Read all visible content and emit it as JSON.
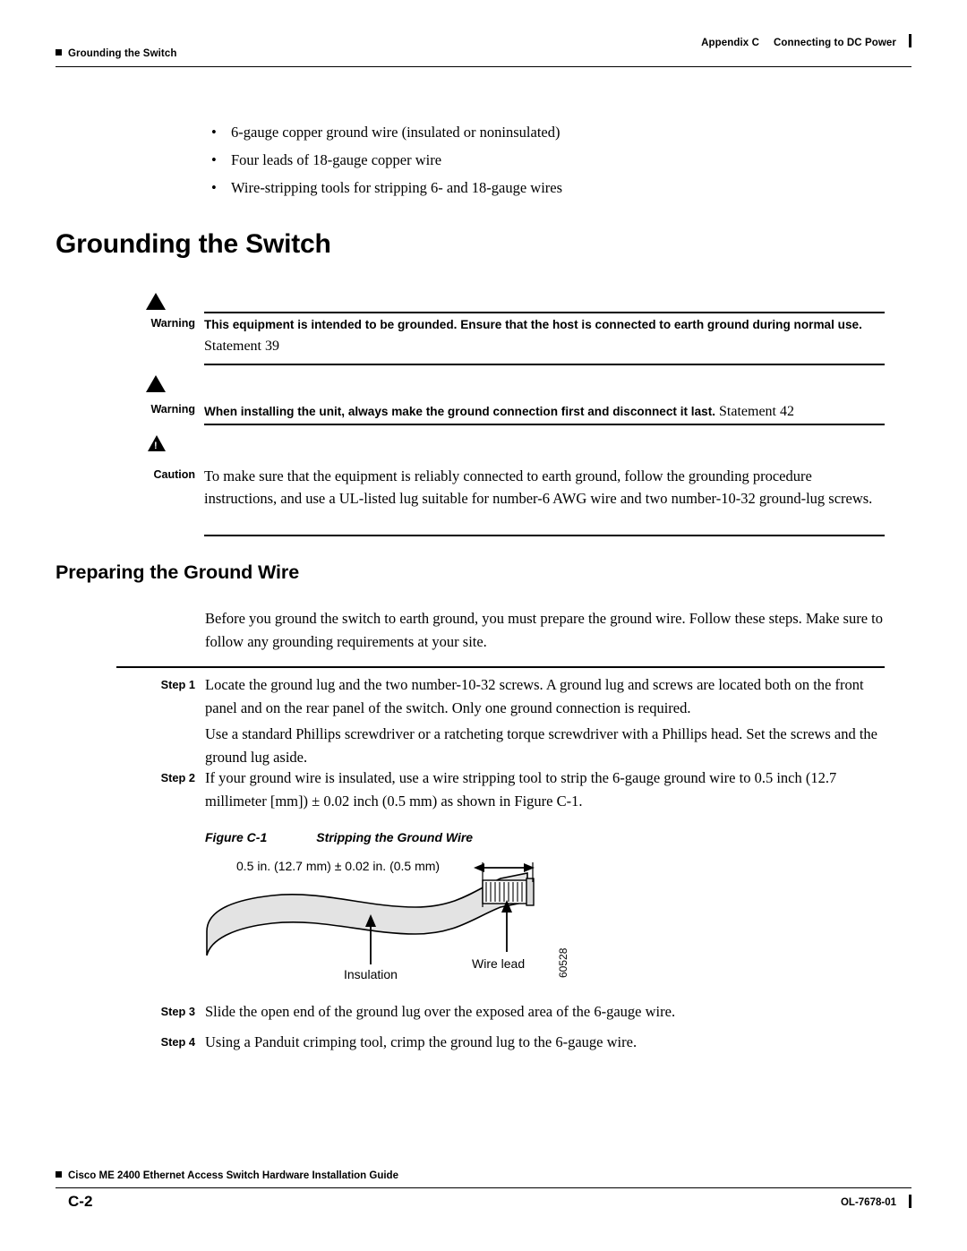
{
  "header": {
    "left_text": "Grounding the Switch",
    "appendix": "Appendix C",
    "chapter": "Connecting to DC Power"
  },
  "bullets": [
    "6-gauge copper ground wire (insulated or noninsulated)",
    "Four leads of 18-gauge copper wire",
    "Wire-stripping tools for stripping 6- and 18-gauge wires"
  ],
  "section_title": "Grounding the Switch",
  "admonitions": [
    {
      "label": "Warning",
      "icon": "warning-triangle-icon",
      "text": "This equipment is intended to be grounded. Ensure that the host is connected to earth ground during normal use.",
      "statement": " Statement 39"
    },
    {
      "label": "Warning",
      "icon": "warning-triangle-icon",
      "text": "When installing the unit, always make the ground connection first and disconnect it last.",
      "statement": " Statement 42"
    },
    {
      "label": "Caution",
      "icon": "caution-triangle-icon",
      "text": "To make sure that the equipment is reliably connected to earth ground, follow the grounding procedure instructions, and use a UL-listed lug suitable for number-6 AWG wire and two number-10-32 ground-lug screws."
    }
  ],
  "subsection_title": "Preparing the Ground Wire",
  "intro_paragraph": "Before you ground the switch to earth ground, you must prepare the ground wire. Follow these steps. Make sure to follow any grounding requirements at your site.",
  "steps": [
    {
      "label": "Step 1",
      "text": "Locate the ground lug and the two number-10-32 screws. A ground lug and screws are located both on the front panel and on the rear panel of the switch. Only one ground connection is required."
    },
    {
      "label": "",
      "text": "Use a standard Phillips screwdriver or a ratcheting torque screwdriver with a Phillips head. Set the screws and the ground lug aside."
    },
    {
      "label": "Step 2",
      "text": "If your ground wire is insulated, use a wire stripping tool to strip the 6-gauge ground wire to 0.5 inch (12.7 millimeter [mm]) ± 0.02 inch (0.5 mm) as shown in ",
      "xref": "Figure C-1",
      "text_after": "."
    },
    {
      "label": "Step 3",
      "text": "Slide the open end of the ground lug over the exposed area of the 6-gauge wire."
    },
    {
      "label": "Step 4",
      "text": "Using a Panduit crimping tool, crimp the ground lug to the 6-gauge wire."
    }
  ],
  "figure": {
    "number": "Figure C-1",
    "title": "Stripping the Ground Wire",
    "dimension_label": "0.5 in. (12.7 mm) ± 0.02 in. (0.5 mm)",
    "insulation_label": "Insulation",
    "wire_lead_label": "Wire lead",
    "art_id": "60528"
  },
  "footer": {
    "guide_title": "Cisco ME 2400 Ethernet Access Switch Hardware Installation Guide",
    "page_number": "C-2",
    "doc_id": "OL-7678-01"
  }
}
